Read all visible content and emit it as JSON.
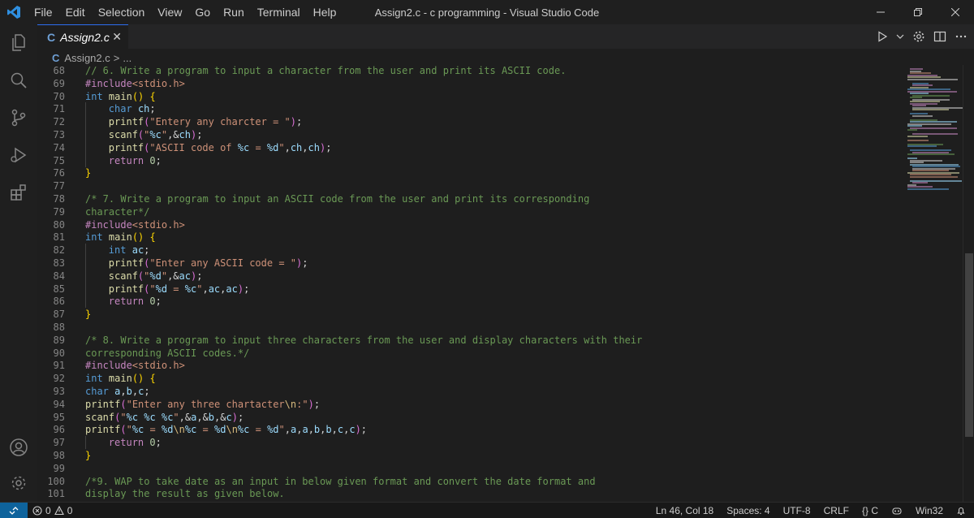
{
  "titlebar": {
    "menus": [
      "File",
      "Edit",
      "Selection",
      "View",
      "Go",
      "Run",
      "Terminal",
      "Help"
    ],
    "title": "Assign2.c - c programming - Visual Studio Code"
  },
  "tab": {
    "lang": "C",
    "name": "Assign2.c",
    "close": "✕"
  },
  "breadcrumb": {
    "lang": "C",
    "file": "Assign2.c",
    "sep": ">",
    "rest": "..."
  },
  "editor": {
    "lines": [
      {
        "n": "68",
        "indent": 0,
        "tokens": [
          [
            "c",
            "// 6. Write a program to input a character from the user and print its ASCII code."
          ]
        ]
      },
      {
        "n": "69",
        "indent": 0,
        "tokens": [
          [
            "pp",
            "#include"
          ],
          [
            "inc",
            "<stdio.h>"
          ]
        ]
      },
      {
        "n": "70",
        "indent": 0,
        "tokens": [
          [
            "kw",
            "int"
          ],
          [
            "p",
            " "
          ],
          [
            "fn",
            "main"
          ],
          [
            "y",
            "()"
          ],
          [
            "p",
            " "
          ],
          [
            "y",
            "{"
          ]
        ]
      },
      {
        "n": "71",
        "indent": 1,
        "tokens": [
          [
            "kw",
            "char"
          ],
          [
            "p",
            " "
          ],
          [
            "v",
            "ch"
          ],
          [
            "p",
            ";"
          ]
        ]
      },
      {
        "n": "72",
        "indent": 1,
        "tokens": [
          [
            "fn",
            "printf"
          ],
          [
            "pa",
            "("
          ],
          [
            "s",
            "\"Entery any charcter = \""
          ],
          [
            "pa",
            ")"
          ],
          [
            "p",
            ";"
          ]
        ]
      },
      {
        "n": "73",
        "indent": 1,
        "tokens": [
          [
            "fn",
            "scanf"
          ],
          [
            "pa",
            "("
          ],
          [
            "s",
            "\""
          ],
          [
            "f",
            "%c"
          ],
          [
            "s",
            "\""
          ],
          [
            "p",
            ",&"
          ],
          [
            "v",
            "ch"
          ],
          [
            "pa",
            ")"
          ],
          [
            "p",
            ";"
          ]
        ]
      },
      {
        "n": "74",
        "indent": 1,
        "tokens": [
          [
            "fn",
            "printf"
          ],
          [
            "pa",
            "("
          ],
          [
            "s",
            "\"ASCII code of "
          ],
          [
            "f",
            "%c"
          ],
          [
            "s",
            " = "
          ],
          [
            "f",
            "%d"
          ],
          [
            "s",
            "\""
          ],
          [
            "p",
            ","
          ],
          [
            "v",
            "ch"
          ],
          [
            "p",
            ","
          ],
          [
            "v",
            "ch"
          ],
          [
            "pa",
            ")"
          ],
          [
            "p",
            ";"
          ]
        ]
      },
      {
        "n": "75",
        "indent": 1,
        "tokens": [
          [
            "ct",
            "return"
          ],
          [
            "p",
            " "
          ],
          [
            "num",
            "0"
          ],
          [
            "p",
            ";"
          ]
        ]
      },
      {
        "n": "76",
        "indent": 0,
        "tokens": [
          [
            "y",
            "}"
          ]
        ]
      },
      {
        "n": "77",
        "indent": 0,
        "tokens": []
      },
      {
        "n": "78",
        "indent": 0,
        "tokens": [
          [
            "c",
            "/* 7. Write a program to input an ASCII code from the user and print its corresponding"
          ]
        ]
      },
      {
        "n": "79",
        "indent": 0,
        "tokens": [
          [
            "c",
            "character*/"
          ]
        ]
      },
      {
        "n": "80",
        "indent": 0,
        "tokens": [
          [
            "pp",
            "#include"
          ],
          [
            "inc",
            "<stdio.h>"
          ]
        ]
      },
      {
        "n": "81",
        "indent": 0,
        "tokens": [
          [
            "kw",
            "int"
          ],
          [
            "p",
            " "
          ],
          [
            "fn",
            "main"
          ],
          [
            "y",
            "()"
          ],
          [
            "p",
            " "
          ],
          [
            "y",
            "{"
          ]
        ]
      },
      {
        "n": "82",
        "indent": 1,
        "tokens": [
          [
            "kw",
            "int"
          ],
          [
            "p",
            " "
          ],
          [
            "v",
            "ac"
          ],
          [
            "p",
            ";"
          ]
        ]
      },
      {
        "n": "83",
        "indent": 1,
        "tokens": [
          [
            "fn",
            "printf"
          ],
          [
            "pa",
            "("
          ],
          [
            "s",
            "\"Enter any ASCII code = \""
          ],
          [
            "pa",
            ")"
          ],
          [
            "p",
            ";"
          ]
        ]
      },
      {
        "n": "84",
        "indent": 1,
        "tokens": [
          [
            "fn",
            "scanf"
          ],
          [
            "pa",
            "("
          ],
          [
            "s",
            "\""
          ],
          [
            "f",
            "%d"
          ],
          [
            "s",
            "\""
          ],
          [
            "p",
            ",&"
          ],
          [
            "v",
            "ac"
          ],
          [
            "pa",
            ")"
          ],
          [
            "p",
            ";"
          ]
        ]
      },
      {
        "n": "85",
        "indent": 1,
        "tokens": [
          [
            "fn",
            "printf"
          ],
          [
            "pa",
            "("
          ],
          [
            "s",
            "\""
          ],
          [
            "f",
            "%d"
          ],
          [
            "s",
            " = "
          ],
          [
            "f",
            "%c"
          ],
          [
            "s",
            "\""
          ],
          [
            "p",
            ","
          ],
          [
            "v",
            "ac"
          ],
          [
            "p",
            ","
          ],
          [
            "v",
            "ac"
          ],
          [
            "pa",
            ")"
          ],
          [
            "p",
            ";"
          ]
        ]
      },
      {
        "n": "86",
        "indent": 1,
        "tokens": [
          [
            "ct",
            "return"
          ],
          [
            "p",
            " "
          ],
          [
            "num",
            "0"
          ],
          [
            "p",
            ";"
          ]
        ]
      },
      {
        "n": "87",
        "indent": 0,
        "tokens": [
          [
            "y",
            "}"
          ]
        ]
      },
      {
        "n": "88",
        "indent": 0,
        "tokens": []
      },
      {
        "n": "89",
        "indent": 0,
        "tokens": [
          [
            "c",
            "/* 8. Write a program to input three characters from the user and display characters with their"
          ]
        ]
      },
      {
        "n": "90",
        "indent": 0,
        "tokens": [
          [
            "c",
            "corresponding ASCII codes.*/"
          ]
        ]
      },
      {
        "n": "91",
        "indent": 0,
        "tokens": [
          [
            "pp",
            "#include"
          ],
          [
            "inc",
            "<stdio.h>"
          ]
        ]
      },
      {
        "n": "92",
        "indent": 0,
        "tokens": [
          [
            "kw",
            "int"
          ],
          [
            "p",
            " "
          ],
          [
            "fn",
            "main"
          ],
          [
            "y",
            "()"
          ],
          [
            "p",
            " "
          ],
          [
            "y",
            "{"
          ]
        ]
      },
      {
        "n": "93",
        "indent": 0,
        "tokens": [
          [
            "kw",
            "char"
          ],
          [
            "p",
            " "
          ],
          [
            "v",
            "a"
          ],
          [
            "p",
            ","
          ],
          [
            "v",
            "b"
          ],
          [
            "p",
            ","
          ],
          [
            "v",
            "c"
          ],
          [
            "p",
            ";"
          ]
        ]
      },
      {
        "n": "94",
        "indent": 0,
        "tokens": [
          [
            "fn",
            "printf"
          ],
          [
            "pa",
            "("
          ],
          [
            "s",
            "\"Enter any three chartacter"
          ],
          [
            "e",
            "\\n"
          ],
          [
            "s",
            ":\""
          ],
          [
            "pa",
            ")"
          ],
          [
            "p",
            ";"
          ]
        ]
      },
      {
        "n": "95",
        "indent": 0,
        "tokens": [
          [
            "fn",
            "scanf"
          ],
          [
            "pa",
            "("
          ],
          [
            "s",
            "\""
          ],
          [
            "f",
            "%c"
          ],
          [
            "s",
            " "
          ],
          [
            "f",
            "%c"
          ],
          [
            "s",
            " "
          ],
          [
            "f",
            "%c"
          ],
          [
            "s",
            "\""
          ],
          [
            "p",
            ",&"
          ],
          [
            "v",
            "a"
          ],
          [
            "p",
            ",&"
          ],
          [
            "v",
            "b"
          ],
          [
            "p",
            ",&"
          ],
          [
            "v",
            "c"
          ],
          [
            "pa",
            ")"
          ],
          [
            "p",
            ";"
          ]
        ]
      },
      {
        "n": "96",
        "indent": 0,
        "tokens": [
          [
            "fn",
            "printf"
          ],
          [
            "pa",
            "("
          ],
          [
            "s",
            "\""
          ],
          [
            "f",
            "%c"
          ],
          [
            "s",
            " = "
          ],
          [
            "f",
            "%d"
          ],
          [
            "e",
            "\\n"
          ],
          [
            "f",
            "%c"
          ],
          [
            "s",
            " = "
          ],
          [
            "f",
            "%d"
          ],
          [
            "e",
            "\\n"
          ],
          [
            "f",
            "%c"
          ],
          [
            "s",
            " = "
          ],
          [
            "f",
            "%d"
          ],
          [
            "s",
            "\""
          ],
          [
            "p",
            ","
          ],
          [
            "v",
            "a"
          ],
          [
            "p",
            ","
          ],
          [
            "v",
            "a"
          ],
          [
            "p",
            ","
          ],
          [
            "v",
            "b"
          ],
          [
            "p",
            ","
          ],
          [
            "v",
            "b"
          ],
          [
            "p",
            ","
          ],
          [
            "v",
            "c"
          ],
          [
            "p",
            ","
          ],
          [
            "v",
            "c"
          ],
          [
            "pa",
            ")"
          ],
          [
            "p",
            ";"
          ]
        ]
      },
      {
        "n": "97",
        "indent": 1,
        "tokens": [
          [
            "ct",
            "return"
          ],
          [
            "p",
            " "
          ],
          [
            "num",
            "0"
          ],
          [
            "p",
            ";"
          ]
        ]
      },
      {
        "n": "98",
        "indent": 0,
        "tokens": [
          [
            "y",
            "}"
          ]
        ]
      },
      {
        "n": "99",
        "indent": 0,
        "tokens": []
      },
      {
        "n": "100",
        "indent": 0,
        "tokens": [
          [
            "c",
            "/*9. WAP to take date as an input in below given format and convert the date format and"
          ]
        ]
      },
      {
        "n": "101",
        "indent": 0,
        "tokens": [
          [
            "c",
            "display the result as given below."
          ]
        ]
      }
    ]
  },
  "statusbar": {
    "errors": "0",
    "warnings": "0",
    "position": "Ln 46, Col 18",
    "spaces": "Spaces: 4",
    "encoding": "UTF-8",
    "eol": "CRLF",
    "language": "C",
    "platform": "Win32"
  },
  "colors": {
    "accent": "#0e639c",
    "comment": "#6a9955",
    "keyword": "#569cd6",
    "function": "#dcdcaa",
    "string": "#ce9178"
  }
}
